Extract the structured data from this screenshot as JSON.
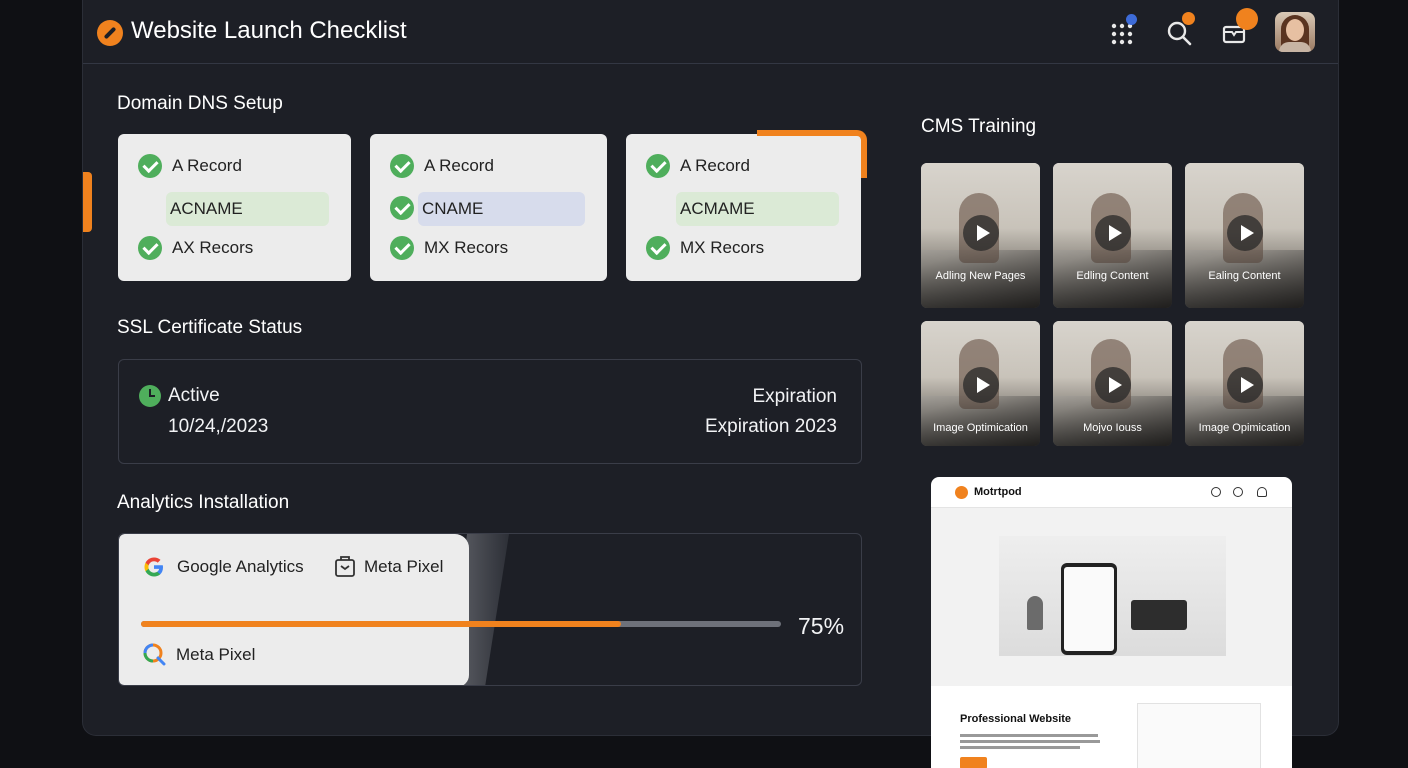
{
  "app": {
    "title": "Website Launch Checklist"
  },
  "topbar": {
    "icons": [
      "grid-icon",
      "search-icon",
      "notification-icon"
    ],
    "avatar": "user-avatar"
  },
  "dns": {
    "title": "Domain DNS Setup",
    "cards": [
      {
        "row1": "A Record",
        "row2": "ACNAME",
        "row3": "AX Recors",
        "pill_color": "#dbead6"
      },
      {
        "row1": "A Record",
        "row2": "CNAME",
        "row3": "MX Recors",
        "pill_color": "#d7dcec"
      },
      {
        "row1": "A Record",
        "row2": "ACMAME",
        "row3": "MX Recors",
        "pill_color": "#dbead6"
      }
    ]
  },
  "ssl": {
    "title": "SSL Certificate Status",
    "status": "Active",
    "date": "10/24,/2023",
    "expiration_label": "Expiration",
    "expiration_value": "Expiration 2023"
  },
  "analytics": {
    "title": "Analytics Installation",
    "items": [
      "Google Analytics",
      "Meta Pixel",
      "Meta Pixel"
    ],
    "progress_percent": 75,
    "progress_label": "75%"
  },
  "cms": {
    "title": "CMS Training",
    "videos": [
      "Adling New Pages",
      "Edling Content",
      "Ealing Content",
      "Image Optimication",
      "Mojvo Iouss",
      "Image Opimication"
    ]
  },
  "preview": {
    "brand": "Motrtpod",
    "heading": "Professional Website"
  },
  "colors": {
    "accent": "#f0821e",
    "check_green": "#4fae5c",
    "background": "#0f1014",
    "panel": "#1d1f26"
  }
}
